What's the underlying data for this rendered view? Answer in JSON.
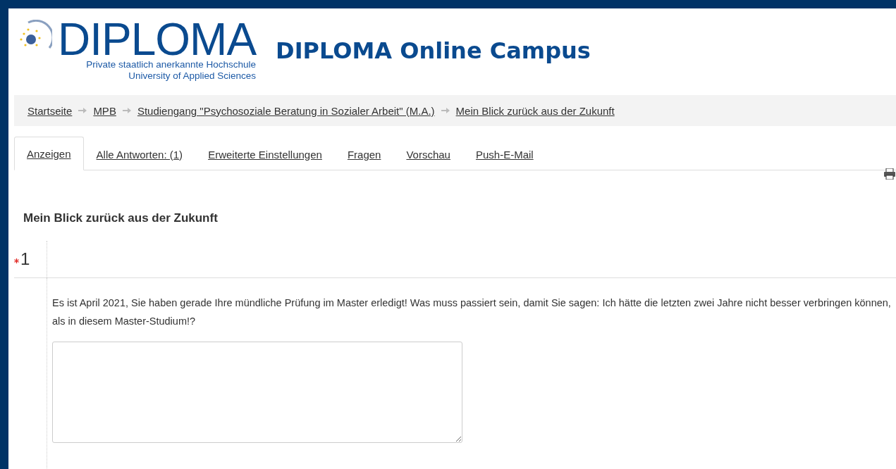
{
  "logo": {
    "wordmark": "DIPLOMA",
    "subtitle_lines": [
      "Private staatlich anerkannte Hochschule",
      "University of Applied Sciences"
    ]
  },
  "site_title": "DIPLOMA Online Campus",
  "breadcrumb": [
    "Startseite",
    "MPB",
    "Studiengang \"Psychosoziale Beratung in Sozialer Arbeit\" (M.A.)",
    "Mein Blick zurück aus der Zukunft"
  ],
  "tabs": [
    {
      "label": "Anzeigen",
      "selected": true
    },
    {
      "label": "Alle Antworten: (1)",
      "selected": false
    },
    {
      "label": "Erweiterte Einstellungen",
      "selected": false
    },
    {
      "label": "Fragen",
      "selected": false
    },
    {
      "label": "Vorschau",
      "selected": false
    },
    {
      "label": "Push-E-Mail",
      "selected": false
    }
  ],
  "page_heading": "Mein Blick zurück aus der Zukunft",
  "questions": [
    {
      "number": "1",
      "required": true,
      "text": "Es ist April 2021, Sie haben gerade Ihre mündliche Prüfung im Master erledigt!  Was muss passiert sein, damit Sie sagen: Ich hätte die letzten zwei Jahre nicht besser verbringen können, als in diesem Master-Studium!?"
    }
  ]
}
